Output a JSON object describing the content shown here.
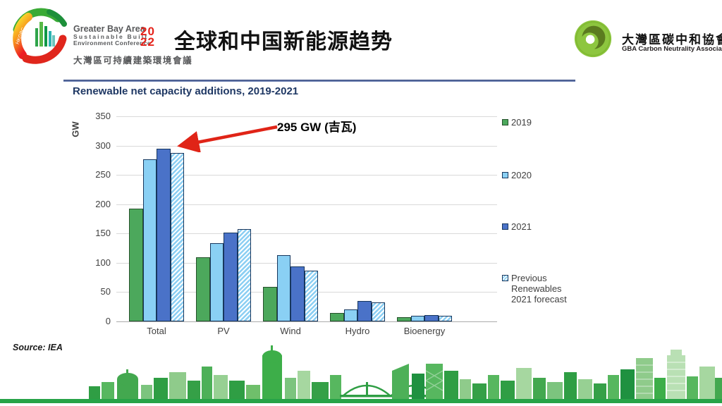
{
  "header": {
    "conference_logo": {
      "name_line1": "Greater Bay Area",
      "name_line2": "Sustainable Built",
      "name_line3": "Environment Conference",
      "year_top": "20",
      "year_bottom": "22",
      "chinese_name": "大灣區可持續建築環境會議"
    },
    "slide_title": "全球和中国新能源趋势",
    "association_logo": {
      "chinese_name": "大灣區碳中和協會",
      "english_name": "GBA Carbon Neutrality Association"
    }
  },
  "chart_data": {
    "type": "bar",
    "title": "Renewable net capacity additions, 2019-2021",
    "xlabel": "",
    "ylabel": "GW",
    "ylim": [
      0,
      350
    ],
    "y_ticks": [
      350,
      300,
      250,
      200,
      150,
      100,
      50,
      0
    ],
    "grid": true,
    "legend_position": "right",
    "categories": [
      "Total",
      "PV",
      "Wind",
      "Hydro",
      "Bioenergy"
    ],
    "series": [
      {
        "name": "2019",
        "color": "#4CA85C",
        "border": "#26512C",
        "hatch": false,
        "values": [
          193,
          110,
          59,
          15,
          7
        ]
      },
      {
        "name": "2020",
        "color": "#8AD0F4",
        "border": "#17375E",
        "hatch": false,
        "values": [
          277,
          134,
          113,
          20,
          10
        ]
      },
      {
        "name": "2021",
        "color": "#4A72C8",
        "border": "#17375E",
        "hatch": false,
        "values": [
          295,
          151,
          94,
          35,
          11
        ]
      },
      {
        "name": "Previous Renewables 2021 forecast",
        "color": "#8AD0F4",
        "border": "#17375E",
        "hatch": true,
        "values": [
          288,
          157,
          87,
          32,
          10
        ]
      }
    ],
    "annotation": {
      "text": "295 GW (吉瓦)",
      "target_series": "2021",
      "target_category": "Total"
    }
  },
  "source_note": "Source: IEA",
  "colors": {
    "chart_title": "#1F3864",
    "axis_text": "#404040",
    "arrow_red": "#E02417",
    "skyline_green": "#27A347"
  }
}
